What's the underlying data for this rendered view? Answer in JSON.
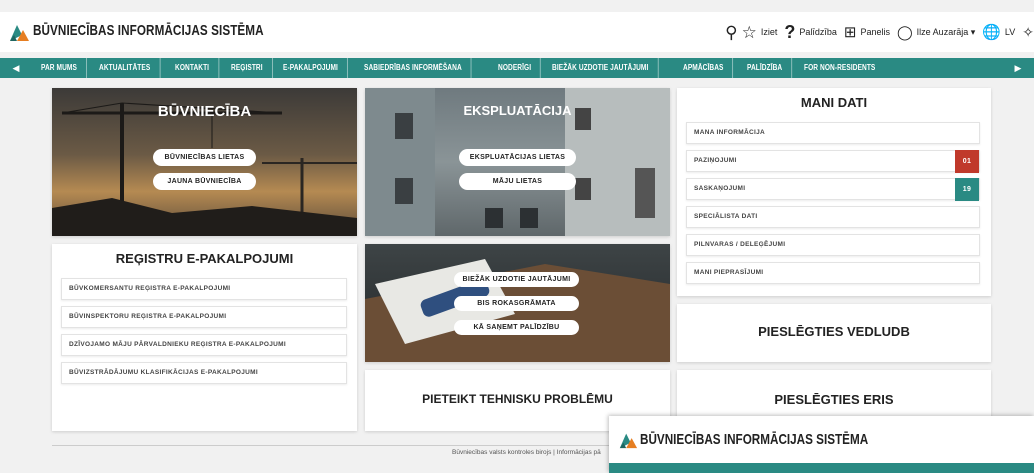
{
  "header": {
    "brand": "BŪVNIECĪBAS INFORMĀCIJAS SISTĒMA",
    "exit_label": "Iziet",
    "help_label": "Palīdzība",
    "panel_label": "Panelis",
    "user_label": "Ilze Auzarāja ▾",
    "lang_label": "LV"
  },
  "nav": {
    "items": [
      "PAR MUMS",
      "AKTUALITĀTES",
      "KONTAKTI",
      "REĢISTRI",
      "E-PAKALPOJUMI",
      "SABIEDRĪBAS INFORMĒŠANA",
      "NODERĪGI",
      "BIEŽĀK UZDOTIE JAUTĀJUMI",
      "APMĀCĪBAS",
      "PALĪDZĪBA",
      "FOR NON-RESIDENTS"
    ]
  },
  "buvnieciba": {
    "title": "BŪVNIECĪBA",
    "btn1": "BŪVNIECĪBAS LIETAS",
    "btn2": "JAUNA BŪVNIECĪBA"
  },
  "ekspluatacija": {
    "title": "EKSPLUATĀCIJA",
    "btn1": "EKSPLUATĀCIJAS LIETAS",
    "btn2": "MĀJU LIETAS"
  },
  "mani_dati": {
    "title": "MANI DATI",
    "items": [
      {
        "label": "MANA INFORMĀCIJA",
        "badge": ""
      },
      {
        "label": "PAZIŅOJUMI",
        "badge": "01"
      },
      {
        "label": "SASKAŅOJUMI",
        "badge": "19"
      },
      {
        "label": "SPECIĀLISTA DATI",
        "badge": ""
      },
      {
        "label": "PILNVARAS / DELEĢĒJUMI",
        "badge": ""
      },
      {
        "label": "MANI PIEPRASĪJUMI",
        "badge": ""
      }
    ],
    "badge_colors": {
      "pazinojumi": "#c0392b",
      "saskanojumi": "#2a8a83"
    }
  },
  "registri": {
    "title": "REĢISTRU E-PAKALPOJUMI",
    "items": [
      "BŪVKOMERSANTU REĢISTRA E-PAKALPOJUMI",
      "BŪVINSPEKTORU REĢISTRA E-PAKALPOJUMI",
      "DZĪVOJAMO MĀJU PĀRVALDNIEKU REĢISTRA E-PAKALPOJUMI",
      "BŪVIZSTRĀDĀJUMU KLASIFIKĀCIJAS E-PAKALPOJUMI"
    ]
  },
  "help_card": {
    "btn1": "BIEŽĀK UZDOTIE JAUTĀJUMI",
    "btn2": "BIS ROKASGRĀMATA",
    "btn3": "KĀ SAŅEMT PALĪDZĪBU"
  },
  "tiles": {
    "vedludb": "PIESLĒGTIES VEDLUDB",
    "tech_problem": "PIETEIKT TEHNISKU PROBLĒMU",
    "eris": "PIESLĒGTIES ERIS"
  },
  "footer": {
    "text": "Būvniecības valsts kontroles birojs | Informācijas pā"
  },
  "overlay": {
    "brand": "BŪVNIECĪBAS INFORMĀCIJAS SISTĒMA"
  },
  "colors": {
    "accent": "#2a8a83",
    "alert": "#c0392b"
  }
}
